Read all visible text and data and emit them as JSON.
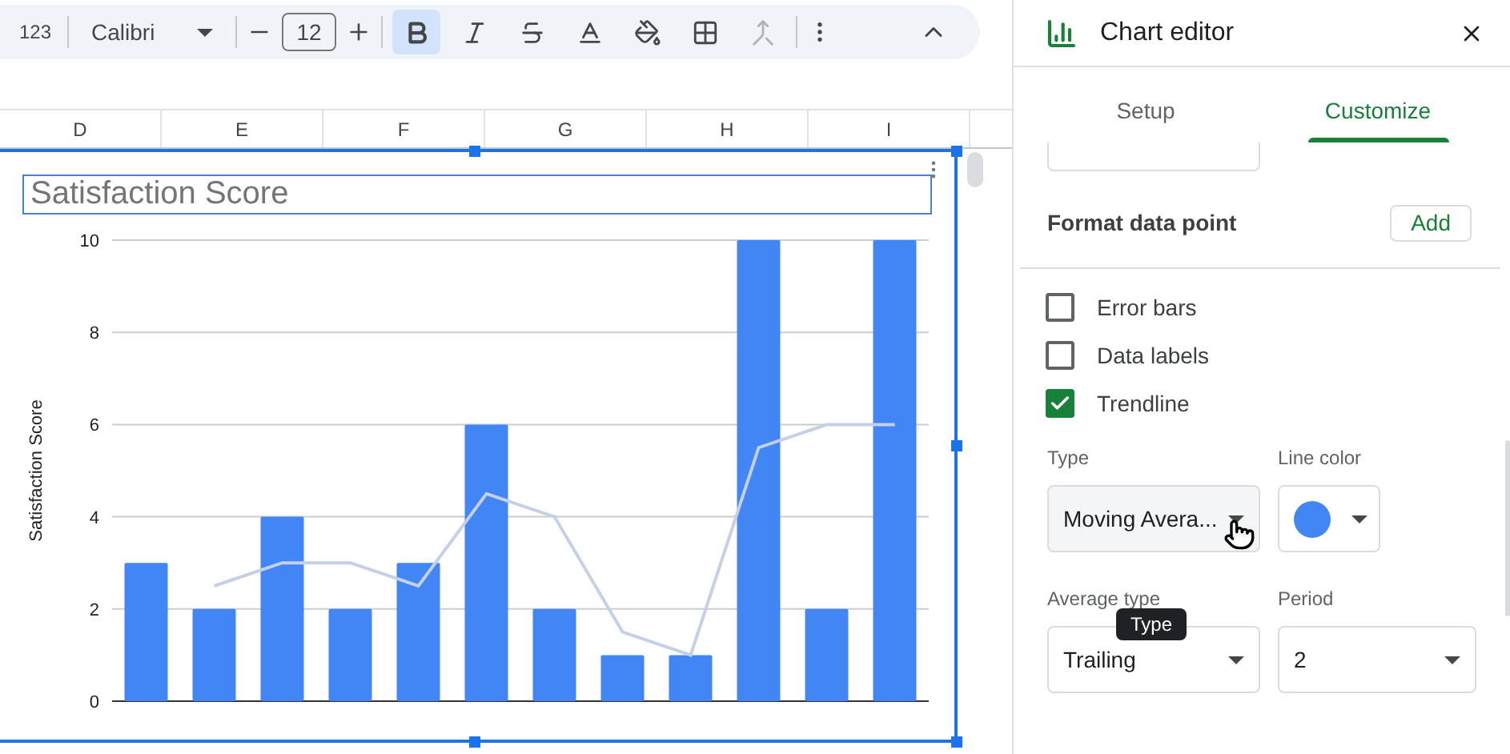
{
  "toolbar": {
    "number_format": "123",
    "font": "Calibri",
    "font_size": "12",
    "buttons": [
      {
        "kind": "bold",
        "selected": true,
        "disabled": false
      },
      {
        "kind": "italic",
        "selected": false,
        "disabled": false
      },
      {
        "kind": "strike",
        "selected": false,
        "disabled": false
      },
      {
        "kind": "textcolor",
        "selected": false,
        "disabled": false
      },
      {
        "kind": "fill",
        "selected": false,
        "disabled": false
      },
      {
        "kind": "borders",
        "selected": false,
        "disabled": false
      },
      {
        "kind": "merge",
        "selected": false,
        "disabled": true
      }
    ]
  },
  "columns": [
    "D",
    "E",
    "F",
    "G",
    "H",
    "I"
  ],
  "chart": {
    "chart_data": {
      "type": "bar",
      "title": "Satisfaction Score",
      "ylabel": "Satisfaction Score",
      "ylim": [
        0,
        10
      ],
      "yticks": [
        0,
        2,
        4,
        6,
        8,
        10
      ],
      "grid": true,
      "series": [
        {
          "color": "#4285f4",
          "values": [
            3,
            2,
            4,
            2,
            3,
            6,
            2,
            1,
            1,
            10,
            2,
            10
          ]
        },
        {
          "type": "line",
          "color": "#c3d0e6",
          "values": [
            null,
            2.5,
            3,
            3,
            2.5,
            4.5,
            4,
            1.5,
            1,
            5.5,
            6,
            6
          ]
        }
      ]
    }
  },
  "editor": {
    "title": "Chart editor",
    "tabs": [
      {
        "label": "Setup",
        "selected": false
      },
      {
        "label": "Customize",
        "selected": true
      }
    ],
    "format_data_point": {
      "label": "Format data point",
      "button": "Add"
    },
    "options": [
      {
        "label": "Error bars",
        "checked": false
      },
      {
        "label": "Data labels",
        "checked": false
      },
      {
        "label": "Trendline",
        "checked": true
      }
    ],
    "fields": [
      {
        "kind": "select",
        "label": "Type",
        "value": "Moving Avera...",
        "hovered": true
      },
      {
        "kind": "color",
        "label": "Line color",
        "color": "#4285f4"
      },
      {
        "kind": "select",
        "label": "Average type",
        "value": "Trailing",
        "hovered": false
      },
      {
        "kind": "select",
        "label": "Period",
        "value": "2",
        "hovered": false
      }
    ],
    "tooltip": "Type"
  }
}
